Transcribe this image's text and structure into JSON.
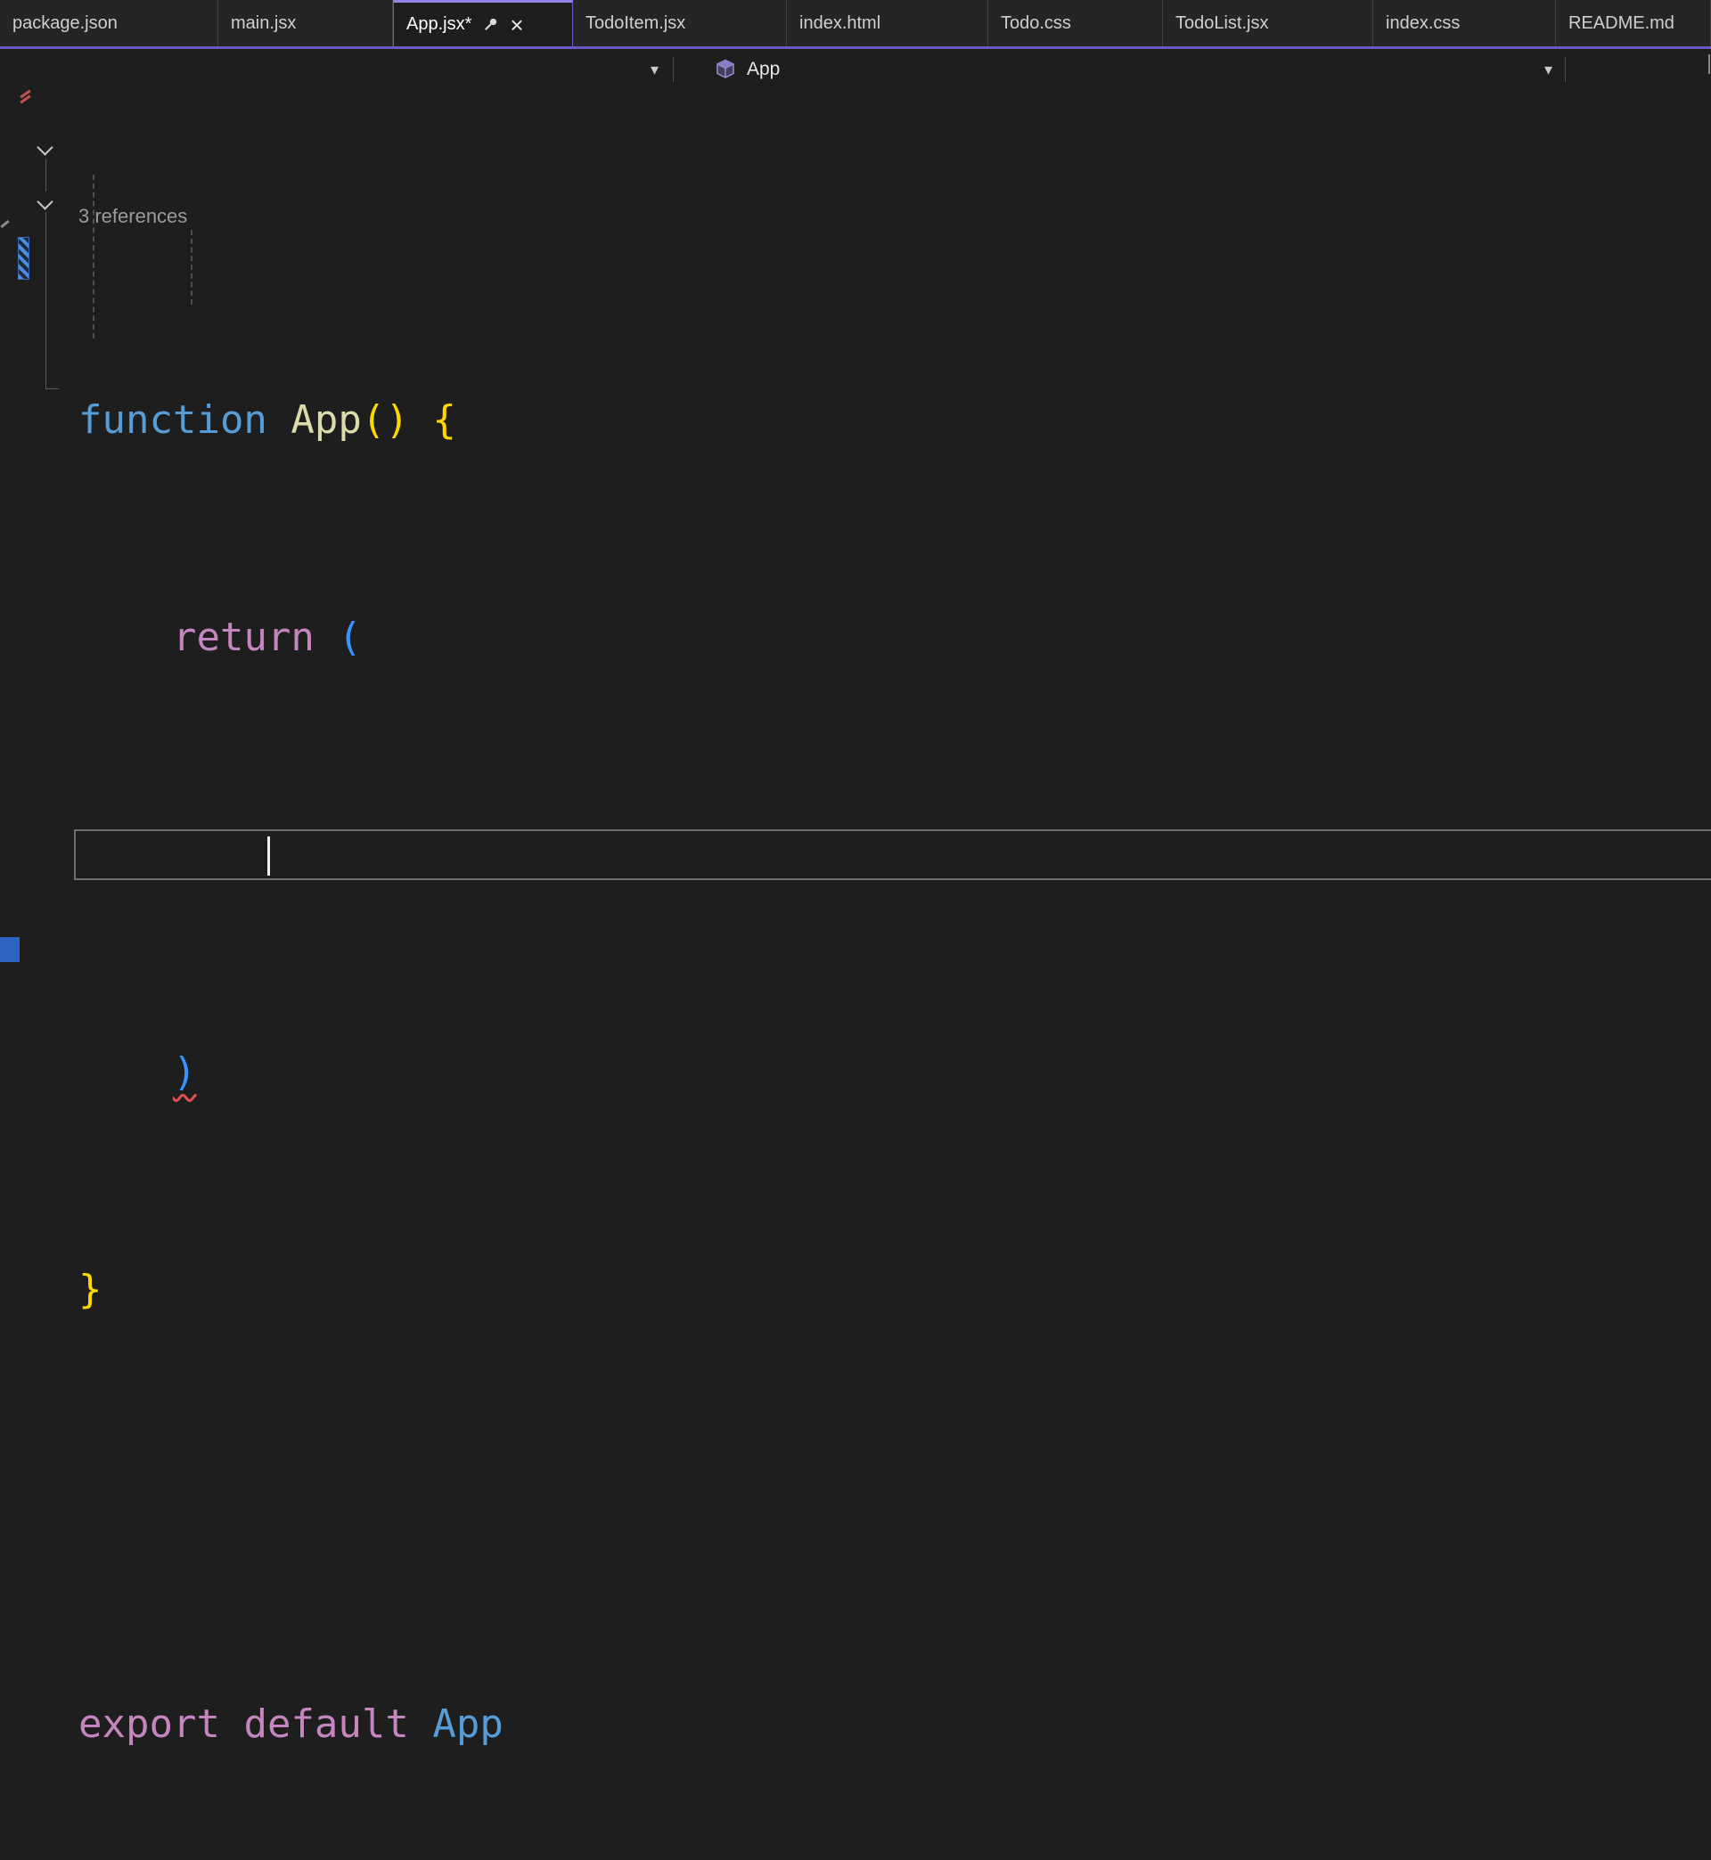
{
  "tabs": [
    {
      "label": "package.json"
    },
    {
      "label": "main.jsx"
    },
    {
      "label": "App.jsx*",
      "active": true,
      "modified": true
    },
    {
      "label": "TodoItem.jsx"
    },
    {
      "label": "index.html"
    },
    {
      "label": "Todo.css"
    },
    {
      "label": "TodoList.jsx"
    },
    {
      "label": "index.css"
    },
    {
      "label": "README.md"
    }
  ],
  "icons": {
    "chevron_down": "▾",
    "close": "×"
  },
  "navbar": {
    "scope": "App"
  },
  "editor": {
    "codelens": "3 references",
    "code": {
      "l1": {
        "kw": "function",
        "sp1": " ",
        "name": "App",
        "parens": "()",
        "sp2": " ",
        "brace": "{"
      },
      "l2": {
        "indent": "    ",
        "kw": "return",
        "sp": " ",
        "paren": "("
      },
      "l3": {
        "indent": "        "
      },
      "l4": {
        "indent": "    ",
        "paren": ")"
      },
      "l5": {
        "brace": "}"
      },
      "l7": {
        "kw1": "export",
        "sp1": " ",
        "kw2": "default",
        "sp2": " ",
        "name": "App"
      }
    }
  },
  "colors": {
    "editor_background": "#1E1E1E",
    "tab_strip_background": "#252526",
    "accent_purple": "#6B5BC7",
    "active_tab_top_border": "#9486E8",
    "keyword_blue": "#569CD6",
    "function_yellow": "#DCDCAA",
    "brace_gold": "#FFD700",
    "keyword_pink": "#C586C0",
    "paren_blue": "#3794FF",
    "error_squiggle_red": "#E05252",
    "codelens_gray": "#9B9B9B",
    "status_corner_blue": "#2D63C2"
  }
}
